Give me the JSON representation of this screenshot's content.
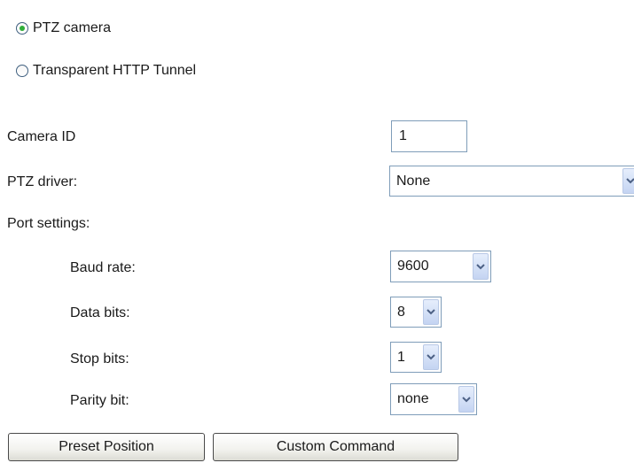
{
  "mode_options": [
    {
      "label": "PTZ camera",
      "selected": true
    },
    {
      "label": "Transparent HTTP Tunnel",
      "selected": false
    }
  ],
  "camera_id": {
    "label": "Camera ID",
    "value": "1"
  },
  "ptz_driver": {
    "label": "PTZ driver:",
    "value": "None"
  },
  "port_settings": {
    "label": "Port settings:",
    "baud_rate": {
      "label": "Baud rate:",
      "value": "9600"
    },
    "data_bits": {
      "label": "Data bits:",
      "value": "8"
    },
    "stop_bits": {
      "label": "Stop bits:",
      "value": "1"
    },
    "parity_bit": {
      "label": "Parity bit:",
      "value": "none"
    }
  },
  "buttons": {
    "preset_position": "Preset Position",
    "custom_command": "Custom Command"
  },
  "colors": {
    "radio_selected": "#2fae3a",
    "input_border": "#7f9db9",
    "dropdown_arrow": "#4d6185"
  }
}
